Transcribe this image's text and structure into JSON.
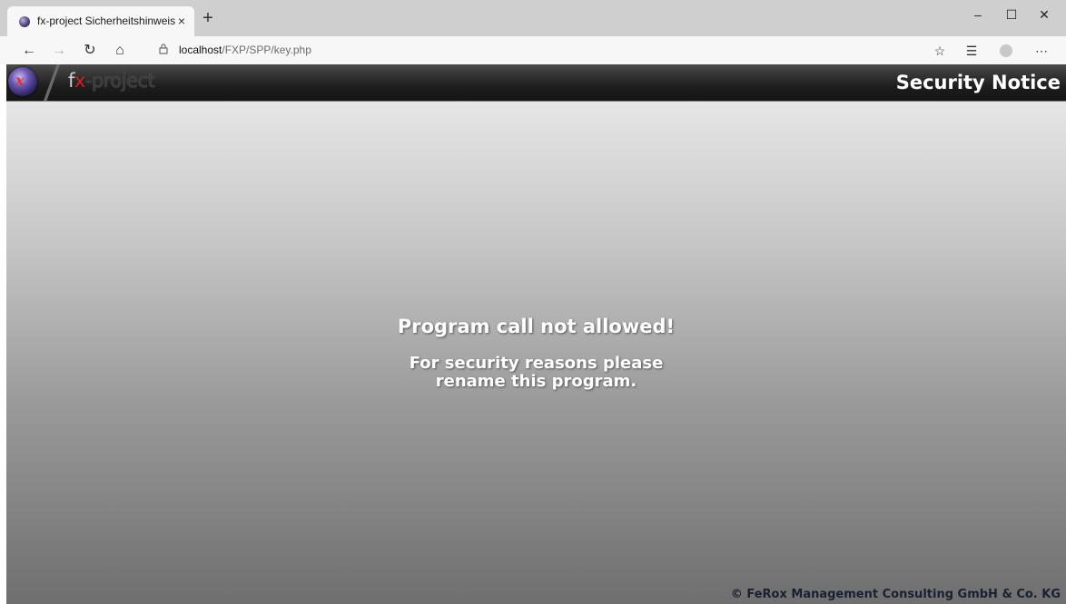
{
  "browser": {
    "tab_title": "fx-project Sicherheitshinweis",
    "tab_close": "×",
    "new_tab": "+",
    "url_host": "localhost",
    "url_path": "/FXP/SPP/key.php",
    "minimize": "–",
    "maximize": "☐",
    "close": "✕",
    "nav": {
      "back": "←",
      "forward": "→",
      "reload": "↻",
      "home": "⌂"
    },
    "toolbar": {
      "favorites": "☆",
      "collections": "☰",
      "more": "⋯"
    }
  },
  "app": {
    "brand_f": "f",
    "brand_x": "x",
    "brand_rest": "-project",
    "header_title": "Security Notice",
    "message_title": "Program call not allowed!",
    "message_line1": "For security reasons please",
    "message_line2": "rename this program.",
    "footer": "© FeRox Management Consulting GmbH & Co. KG"
  },
  "colors": {
    "header_bg": "#1e1e1e",
    "brand_x": "#d21f1f",
    "footer_text": "#1a2030"
  }
}
